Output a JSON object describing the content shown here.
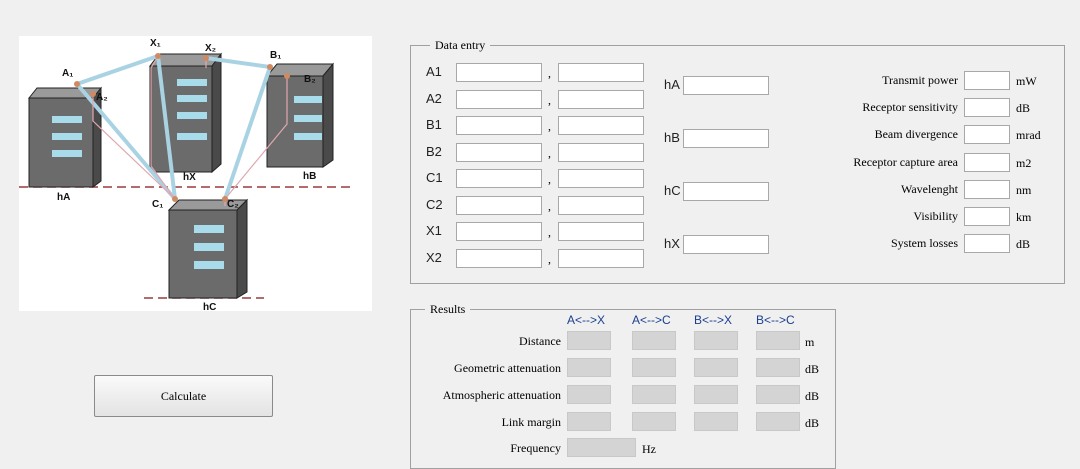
{
  "diagram": {
    "points": {
      "A1": "A₁",
      "A2": "A₂",
      "X1": "X₁",
      "X2": "X₂",
      "B1": "B₁",
      "B2": "B₂",
      "C1": "C₁",
      "C2": "C₂"
    },
    "buildings": {
      "hA": "hA",
      "hX": "hX",
      "hB": "hB",
      "hC": "hC"
    }
  },
  "calculate_label": "Calculate",
  "data_entry": {
    "title": "Data entry",
    "coords": [
      {
        "label": "A1",
        "x": "",
        "y": ""
      },
      {
        "label": "A2",
        "x": "",
        "y": ""
      },
      {
        "label": "B1",
        "x": "",
        "y": ""
      },
      {
        "label": "B2",
        "x": "",
        "y": ""
      },
      {
        "label": "C1",
        "x": "",
        "y": ""
      },
      {
        "label": "C2",
        "x": "",
        "y": ""
      },
      {
        "label": "X1",
        "x": "",
        "y": ""
      },
      {
        "label": "X2",
        "x": "",
        "y": ""
      }
    ],
    "separator": ",",
    "heights": [
      {
        "label": "hA",
        "value": ""
      },
      {
        "label": "hB",
        "value": ""
      },
      {
        "label": "hC",
        "value": ""
      },
      {
        "label": "hX",
        "value": ""
      }
    ],
    "params": [
      {
        "label": "Transmit power",
        "value": "",
        "unit": "mW"
      },
      {
        "label": "Receptor sensitivity",
        "value": "",
        "unit": "dB"
      },
      {
        "label": "Beam divergence",
        "value": "",
        "unit": "mrad"
      },
      {
        "label": "Receptor capture area",
        "value": "",
        "unit": "m2"
      },
      {
        "label": "Wavelenght",
        "value": "",
        "unit": "nm"
      },
      {
        "label": "Visibility",
        "value": "",
        "unit": "km"
      },
      {
        "label": "System losses",
        "value": "",
        "unit": "dB"
      }
    ]
  },
  "results": {
    "title": "Results",
    "columns": [
      "A<-->X",
      "A<-->C",
      "B<-->X",
      "B<-->C"
    ],
    "rows": [
      {
        "label": "Distance",
        "unit": "m"
      },
      {
        "label": "Geometric attenuation",
        "unit": "dB"
      },
      {
        "label": "Atmospheric attenuation",
        "unit": "dB"
      },
      {
        "label": "Link margin",
        "unit": "dB"
      }
    ],
    "frequency": {
      "label": "Frequency",
      "unit": "Hz"
    }
  }
}
